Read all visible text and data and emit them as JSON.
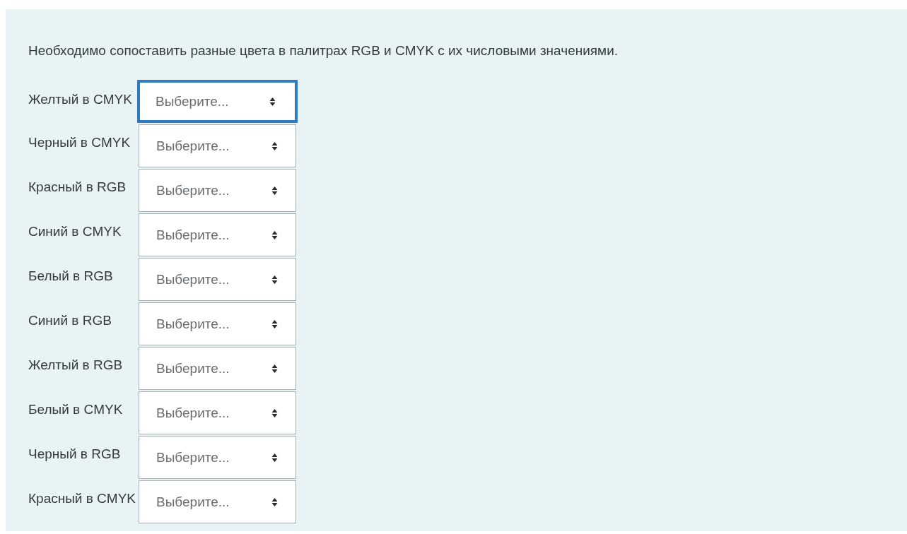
{
  "question": {
    "prompt": "Необходимо сопоставить разные цвета в палитрах RGB и CMYK с их числовыми значениями.",
    "rows": [
      {
        "label": "Желтый в CMYK",
        "value": "Выберите...",
        "focused": true
      },
      {
        "label": "Черный в CMYK",
        "value": "Выберите...",
        "focused": false
      },
      {
        "label": "Красный в RGB",
        "value": "Выберите...",
        "focused": false
      },
      {
        "label": "Синий в CMYK",
        "value": "Выберите...",
        "focused": false
      },
      {
        "label": "Белый в RGB",
        "value": "Выберите...",
        "focused": false
      },
      {
        "label": "Синий в RGB",
        "value": "Выберите...",
        "focused": false
      },
      {
        "label": "Желтый в RGB",
        "value": "Выберите...",
        "focused": false
      },
      {
        "label": "Белый в CMYK",
        "value": "Выберите...",
        "focused": false
      },
      {
        "label": "Черный в RGB",
        "value": "Выберите...",
        "focused": false
      },
      {
        "label": "Красный в CMYK",
        "value": "Выберите...",
        "focused": false
      }
    ]
  }
}
